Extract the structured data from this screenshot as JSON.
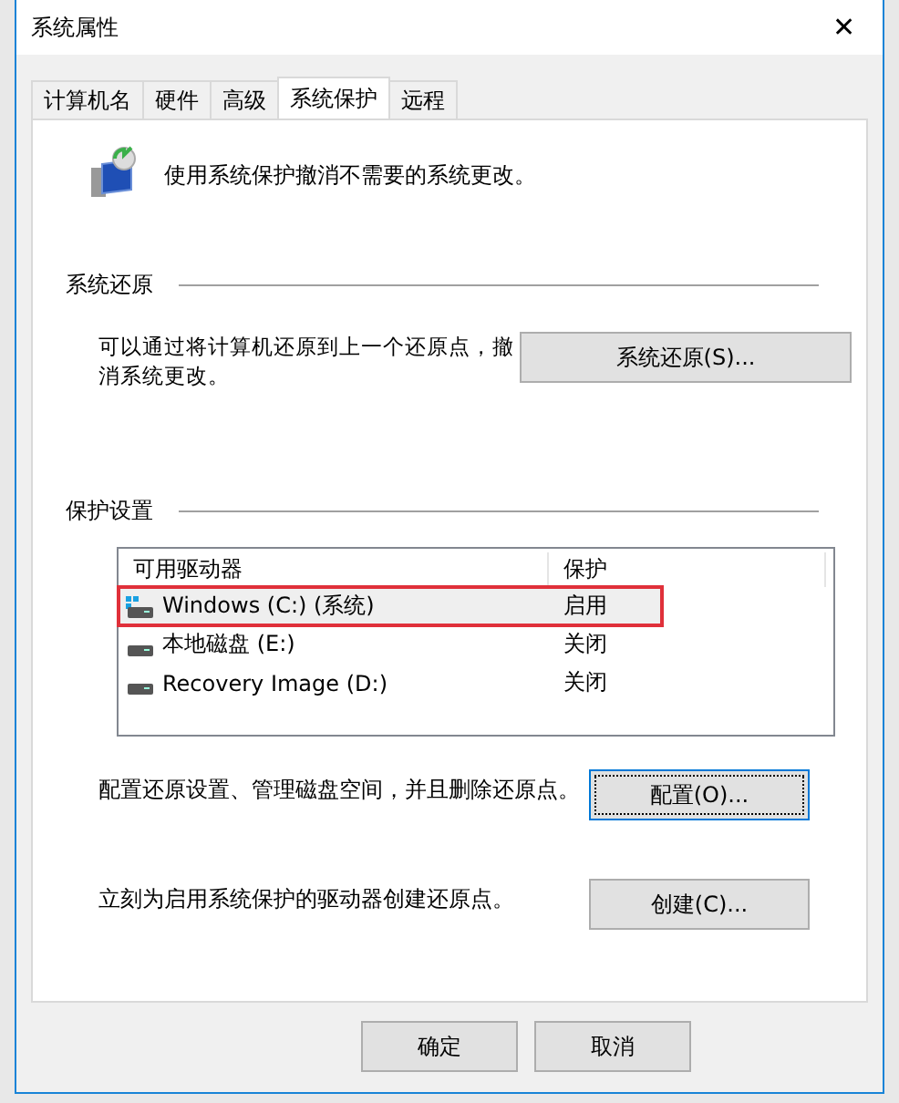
{
  "window": {
    "title": "系统属性",
    "close": "✕"
  },
  "tabs": [
    {
      "label": "计算机名",
      "selected": false
    },
    {
      "label": "硬件",
      "selected": false
    },
    {
      "label": "高级",
      "selected": false
    },
    {
      "label": "系统保护",
      "selected": true
    },
    {
      "label": "远程",
      "selected": false
    }
  ],
  "intro": "使用系统保护撤消不需要的系统更改。",
  "restore": {
    "heading": "系统还原",
    "text": "可以通过将计算机还原到上一个还原点，撤消系统更改。",
    "button": "系统还原(S)..."
  },
  "protection": {
    "heading": "保护设置",
    "columns": [
      "可用驱动器",
      "保护"
    ],
    "rows": [
      {
        "drive": "Windows (C:) (系统)",
        "status": "启用",
        "kind": "system",
        "selected": true,
        "outlined": true
      },
      {
        "drive": "本地磁盘 (E:)",
        "status": "关闭",
        "kind": "disk",
        "selected": false,
        "outlined": false
      },
      {
        "drive": "Recovery Image (D:)",
        "status": "关闭",
        "kind": "disk",
        "selected": false,
        "outlined": false
      }
    ],
    "actions": [
      {
        "text": "配置还原设置、管理磁盘空间，并且删除还原点。",
        "button": "配置(O)...",
        "focused": true
      },
      {
        "text": "立刻为启用系统保护的驱动器创建还原点。",
        "button": "创建(C)...",
        "focused": false
      }
    ]
  },
  "buttons": [
    "确定",
    "取消"
  ]
}
